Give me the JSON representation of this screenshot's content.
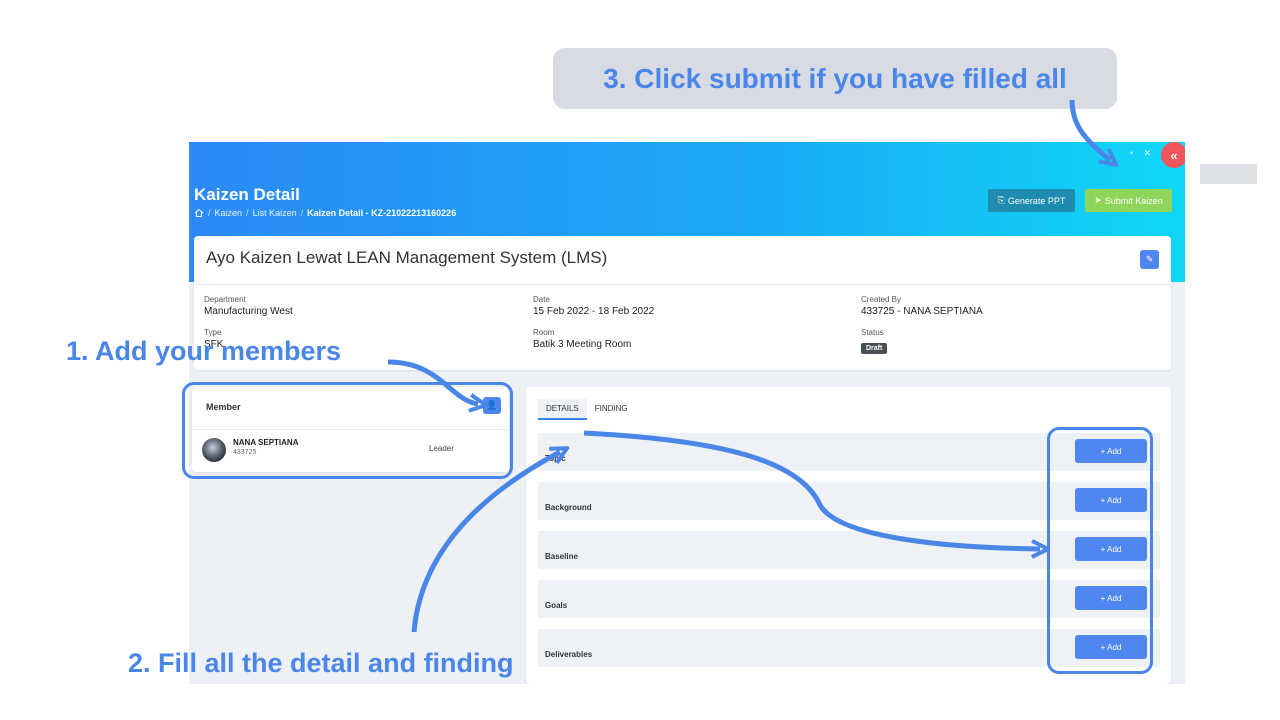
{
  "annotations": {
    "step1": "1. Add your members",
    "step2": "2. Fill all the detail and finding",
    "step3": "3. Click submit if you have filled all"
  },
  "header": {
    "title": "Kaizen Detail",
    "breadcrumb": [
      "Kaizen",
      "List Kaizen",
      "Kaizen Detail - KZ-21022213160226"
    ],
    "generate_ppt": "Generate PPT",
    "submit_kaizen": "Submit Kaizen",
    "collapse": "«"
  },
  "kaizen": {
    "title": "Ayo Kaizen Lewat LEAN Management System (LMS)",
    "department_label": "Department",
    "department": "Manufacturing West",
    "type_label": "Type",
    "type": "SFK",
    "date_label": "Date",
    "date": "15 Feb 2022 - 18 Feb 2022",
    "room_label": "Room",
    "room": "Batik 3 Meeting Room",
    "created_by_label": "Created By",
    "created_by": "433725 - NANA SEPTIANA",
    "status_label": "Status",
    "status": "Draft"
  },
  "member": {
    "heading": "Member",
    "name": "NANA SEPTIANA",
    "nik": "433725",
    "role": "Leader"
  },
  "tabs": [
    "DETAILS",
    "FINDING"
  ],
  "sections": [
    {
      "label": "Topic",
      "add": "+ Add"
    },
    {
      "label": "Background",
      "add": "+ Add"
    },
    {
      "label": "Baseline",
      "add": "+ Add"
    },
    {
      "label": "Goals",
      "add": "+ Add"
    },
    {
      "label": "Deliverables",
      "add": "+ Add"
    }
  ],
  "colors": {
    "accent": "#4a86e8",
    "header_start": "#2b8af7",
    "header_end": "#10d7f6",
    "submit": "#8fd55a",
    "ppt": "#1d8cae",
    "collapse": "#f2545b"
  }
}
